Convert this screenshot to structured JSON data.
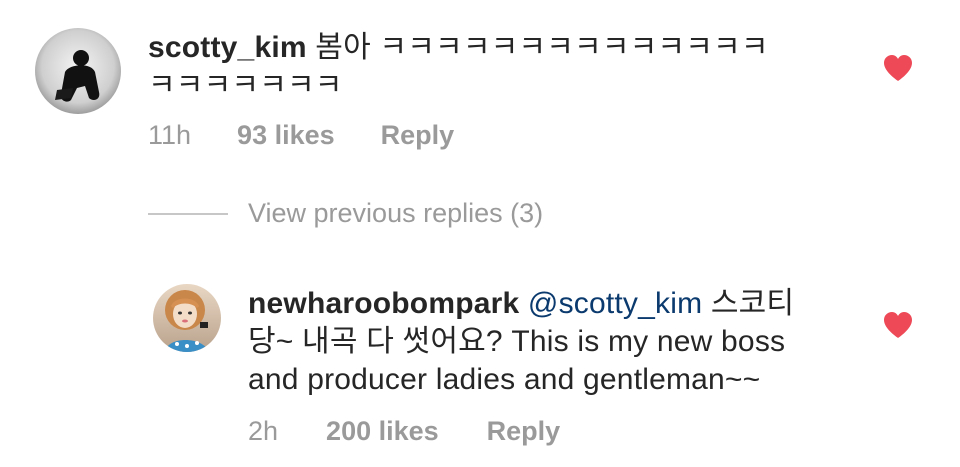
{
  "comment_1": {
    "username": "scotty_kim",
    "text": "봄아 ㅋㅋㅋㅋㅋㅋㅋㅋㅋㅋㅋㅋㅋㅋ",
    "text_line2": "ㅋㅋㅋㅋㅋㅋㅋ",
    "time": "11h",
    "likes": "93 likes",
    "reply": "Reply",
    "liked": true
  },
  "view_replies": {
    "label": "View previous replies (3)"
  },
  "comment_2": {
    "username": "newharoobompark",
    "mention": "@scotty_kim",
    "text_inline": "스코티",
    "text_line2": "당~ 내곡 다 썻어요? This is my new boss",
    "text_line3": "and producer ladies and gentleman~~",
    "time": "2h",
    "likes": "200 likes",
    "reply": "Reply",
    "liked": true
  },
  "colors": {
    "heart": "#ed4956",
    "meta_gray": "#9a9a9a",
    "mention_blue": "#0b3a6e"
  },
  "icons": {
    "heart": "heart-icon"
  }
}
